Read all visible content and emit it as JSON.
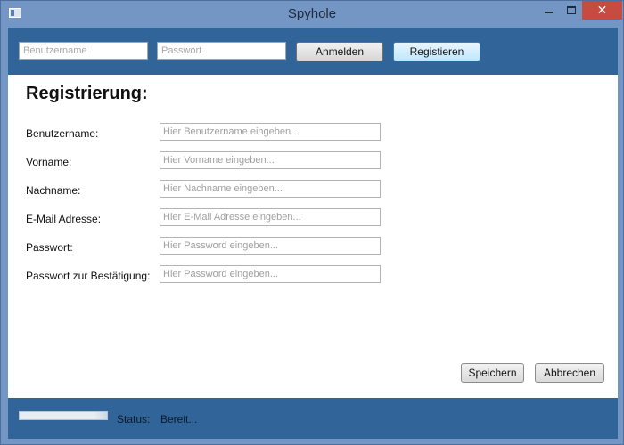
{
  "window": {
    "title": "Spyhole",
    "close_glyph": "✕"
  },
  "topbar": {
    "username_placeholder": "Benutzername",
    "password_placeholder": "Passwort",
    "login_label": "Anmelden",
    "register_label": "Registieren"
  },
  "form": {
    "heading": "Registrierung:",
    "fields": [
      {
        "label": "Benutzername:",
        "placeholder": "Hier Benutzername eingeben..."
      },
      {
        "label": "Vorname:",
        "placeholder": "Hier Vorname eingeben..."
      },
      {
        "label": "Nachname:",
        "placeholder": "Hier Nachname eingeben..."
      },
      {
        "label": "E-Mail Adresse:",
        "placeholder": "Hier E-Mail Adresse eingeben..."
      },
      {
        "label": "Passwort:",
        "placeholder": "Hier Password eingeben..."
      },
      {
        "label": "Passwort zur Bestätigung:",
        "placeholder": "Hier Password eingeben..."
      }
    ],
    "save_label": "Speichern",
    "cancel_label": "Abbrechen"
  },
  "statusbar": {
    "label": "Status:",
    "text": "Bereit...",
    "progress": 0
  },
  "colors": {
    "window_frame": "#7396c4",
    "toolbar": "#316499",
    "close": "#c74b40"
  },
  "icons": {
    "app": "app-icon",
    "minimize": "minimize-icon",
    "maximize": "maximize-icon",
    "close": "close-icon"
  }
}
